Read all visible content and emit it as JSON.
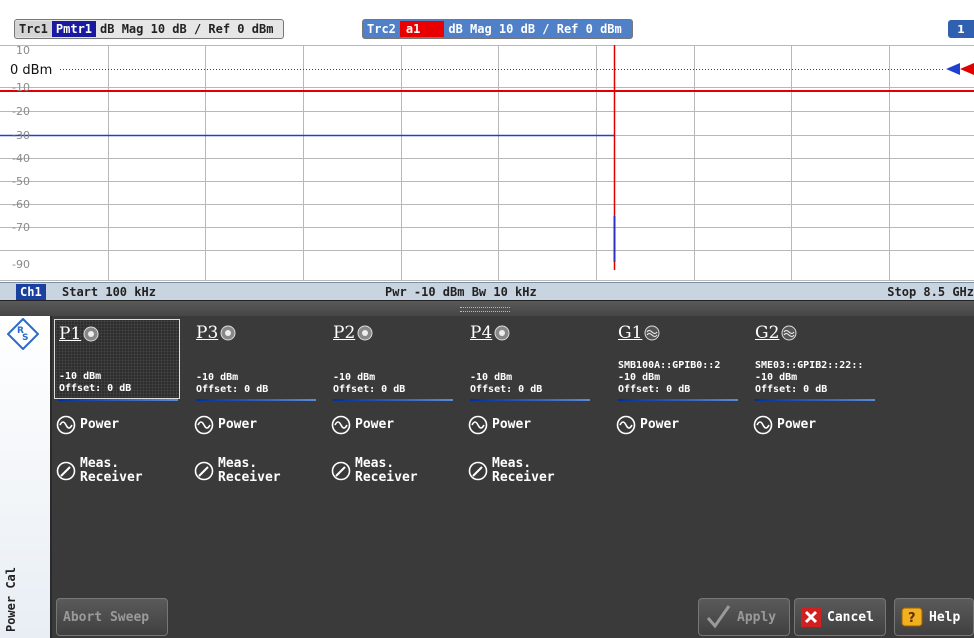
{
  "trace_header": {
    "trc1": "Trc1",
    "pmtr1": "Pmtr1",
    "trc1_desc": "dB Mag  10 dB / Ref 0 dBm",
    "trc2": "Trc2",
    "a1": "a1",
    "trc2_desc": "dB Mag  10 dB / Ref 0 dBm",
    "badge": "1"
  },
  "diagram": {
    "ref_label": "0 dBm",
    "y_ticks": [
      "10",
      "-10",
      "-20",
      "-30",
      "-40",
      "-50",
      "-60",
      "-70",
      "-90"
    ]
  },
  "channel_bar": {
    "ch": "Ch1",
    "start": "Start  100 kHz",
    "mid": "Pwr  -10 dBm   Bw  10 kHz",
    "stop": "Stop  8.5 GHz"
  },
  "sidebar": {
    "label": "Power Cal"
  },
  "ports": [
    {
      "name": "P1",
      "sub": "-10 dBm\nOffset: 0 dB",
      "power": "Power",
      "meas": "Meas.\nReceiver",
      "icon": "connector-icon"
    },
    {
      "name": "P3",
      "sub": "-10 dBm\nOffset: 0 dB",
      "power": "Power",
      "meas": "Meas.\nReceiver",
      "icon": "connector-icon"
    },
    {
      "name": "P2",
      "sub": "-10 dBm\nOffset: 0 dB",
      "power": "Power",
      "meas": "Meas.\nReceiver",
      "icon": "connector-icon"
    },
    {
      "name": "P4",
      "sub": "-10 dBm\nOffset: 0 dB",
      "power": "Power",
      "meas": "Meas.\nReceiver",
      "icon": "connector-icon"
    },
    {
      "name": "G1",
      "sub": "SMB100A::GPIB0::2\n-10 dBm\nOffset: 0 dB",
      "power": "Power",
      "icon": "generator-icon"
    },
    {
      "name": "G2",
      "sub": "SME03::GPIB2::22::\n-10 dBm\nOffset: 0 dB",
      "power": "Power",
      "icon": "generator-icon"
    }
  ],
  "footer": {
    "abort": "Abort Sweep",
    "apply": "Apply",
    "cancel": "Cancel",
    "help": "Help"
  },
  "colors": {
    "trace1": "#2040d0",
    "trace2": "#e00000",
    "accent": "#1a1aa0"
  }
}
